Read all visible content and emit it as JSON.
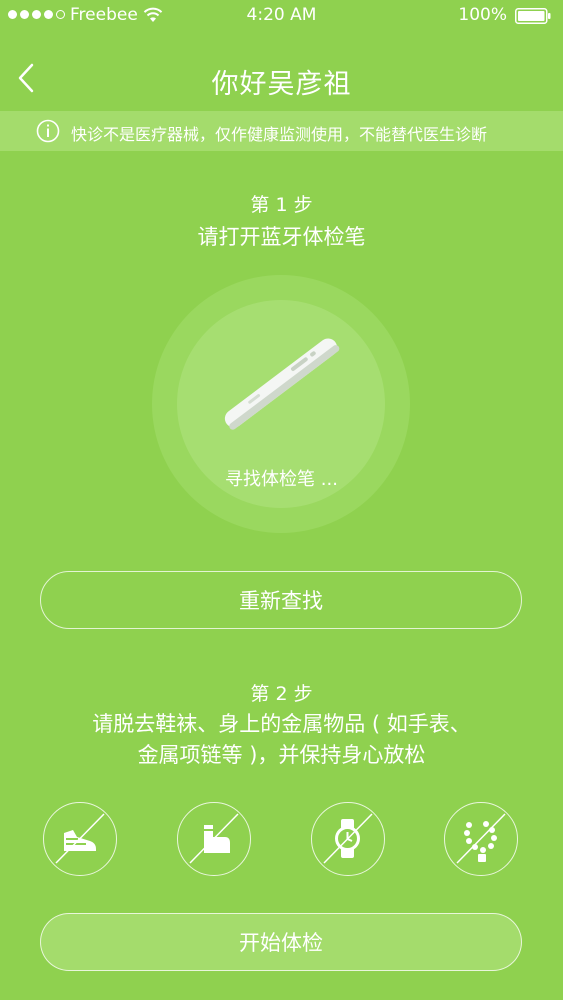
{
  "status_bar": {
    "carrier": "Freebee",
    "time": "4:20 AM",
    "battery": "100%"
  },
  "nav": {
    "title": "你好吴彦祖"
  },
  "notice": {
    "text": "快诊不是医疗器械，仅作健康监测使用，不能替代医生诊断"
  },
  "step1": {
    "label": "第 1 步",
    "description": "请打开蓝牙体检笔",
    "searching_text": "寻找体检笔 ...",
    "button": "重新查找"
  },
  "step2": {
    "label": "第 2 步",
    "description_line1": "请脱去鞋袜、身上的金属物品 ( 如手表、",
    "description_line2": "金属项链等 )，并保持身心放松",
    "icons": [
      "shoe-icon",
      "sock-icon",
      "watch-icon",
      "necklace-icon"
    ]
  },
  "start_button": "开始体检"
}
